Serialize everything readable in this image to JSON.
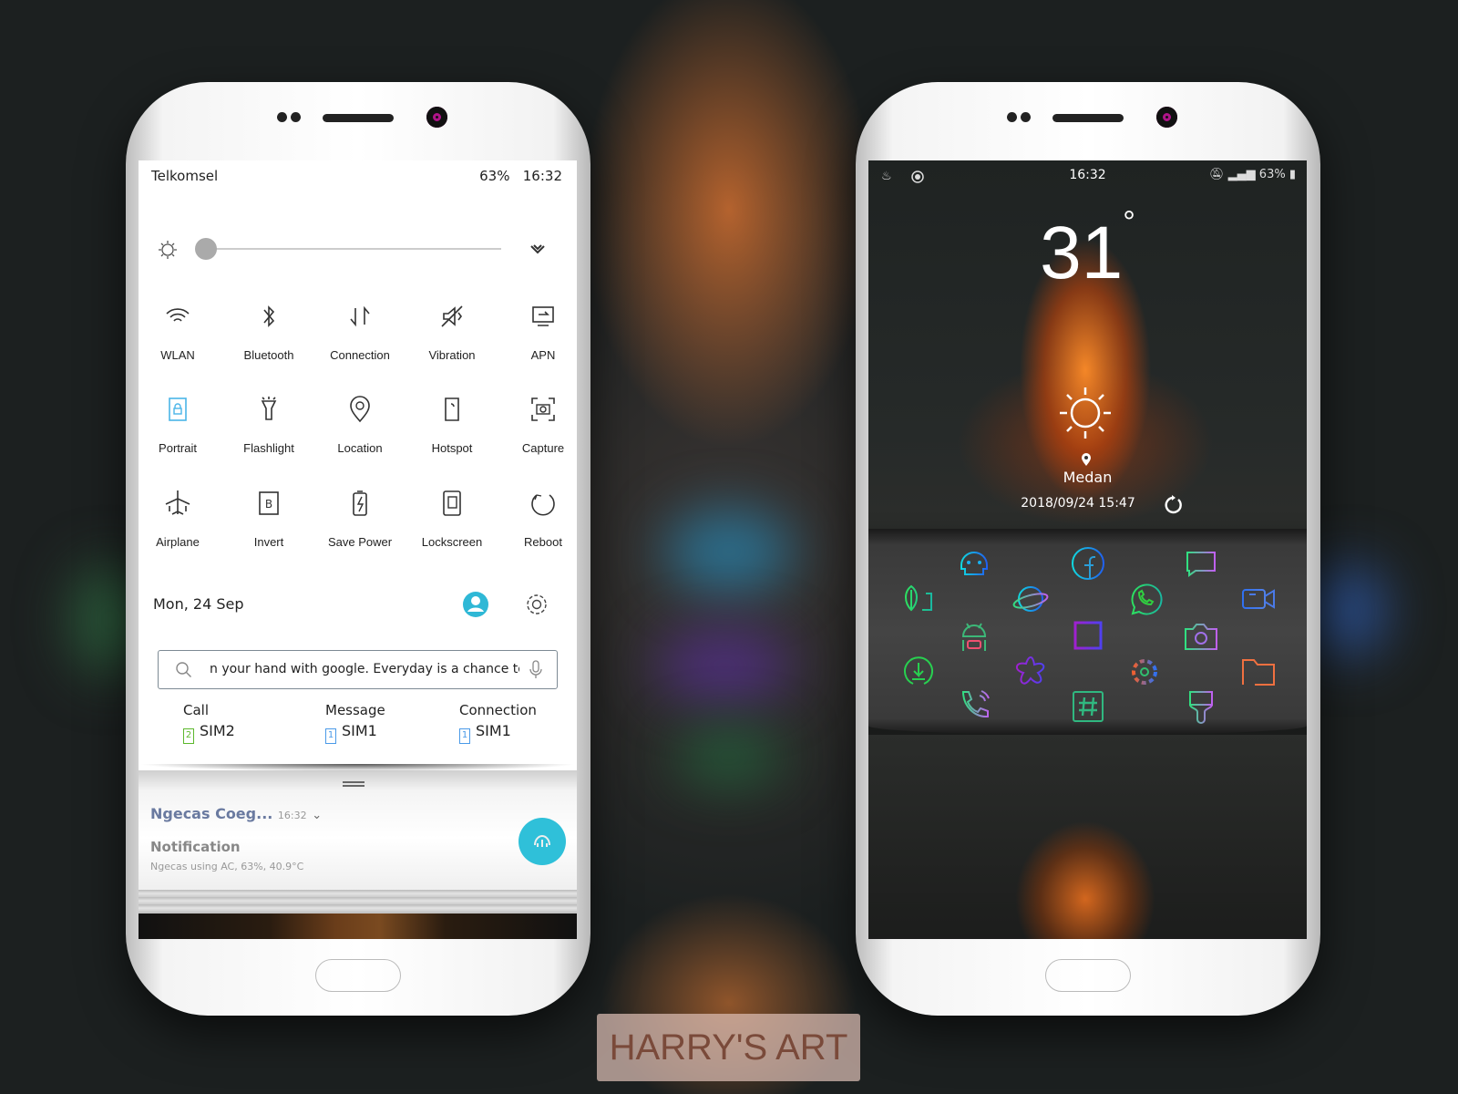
{
  "left_phone": {
    "status": {
      "carrier": "Telkomsel",
      "battery": "63%",
      "time": "16:32"
    },
    "brightness": {
      "level": 0.0
    },
    "quick_settings": [
      {
        "label": "WLAN",
        "icon": "wifi-icon",
        "active": false
      },
      {
        "label": "Bluetooth",
        "icon": "bluetooth-icon",
        "active": false
      },
      {
        "label": "Connection",
        "icon": "data-arrows-icon",
        "active": false
      },
      {
        "label": "Vibration",
        "icon": "mute-vibrate-icon",
        "active": false
      },
      {
        "label": "APN",
        "icon": "apn-icon",
        "active": false
      },
      {
        "label": "Portrait",
        "icon": "rotation-lock-icon",
        "active": true
      },
      {
        "label": "Flashlight",
        "icon": "flashlight-icon",
        "active": false
      },
      {
        "label": "Location",
        "icon": "location-icon",
        "active": false
      },
      {
        "label": "Hotspot",
        "icon": "hotspot-icon",
        "active": false
      },
      {
        "label": "Capture",
        "icon": "screenshot-icon",
        "active": false
      },
      {
        "label": "Airplane",
        "icon": "airplane-icon",
        "active": false
      },
      {
        "label": "Invert",
        "icon": "invert-icon",
        "active": false
      },
      {
        "label": "Save Power",
        "icon": "battery-saver-icon",
        "active": false
      },
      {
        "label": "Lockscreen",
        "icon": "lockscreen-icon",
        "active": false
      },
      {
        "label": "Reboot",
        "icon": "reboot-icon",
        "active": false
      }
    ],
    "date": "Mon, 24 Sep",
    "search": {
      "value": "n your hand with google. Everyday is a chance to"
    },
    "sim": [
      {
        "label": "Call",
        "sim": "SIM2",
        "num": "2",
        "color": "#5cb82c"
      },
      {
        "label": "Message",
        "sim": "SIM1",
        "num": "1",
        "color": "#4a9ae8"
      },
      {
        "label": "Connection",
        "sim": "SIM1",
        "num": "1",
        "color": "#4a9ae8"
      }
    ],
    "notification": {
      "app": "Ngecas Coeg...",
      "time": "16:32",
      "title": "Notification",
      "text": "Ngecas using AC, 63%, 40.9°C"
    },
    "accent": "#2fb8d6"
  },
  "right_phone": {
    "status": {
      "time": "16:32",
      "battery": "63%"
    },
    "weather": {
      "temp": "31",
      "degree": "°",
      "city": "Medan",
      "updated": "2018/09/24 15:47",
      "icon": "sun-icon"
    },
    "apps": [
      "leaf-app-icon",
      "skull-app-icon",
      "facebook-icon",
      "message-icon",
      "browser-planet-icon",
      "whatsapp-icon",
      "video-icon",
      "android-icon",
      "square-app-icon",
      "camera-icon",
      "download-icon",
      "flower-app-icon",
      "settings-icon",
      "folder-icon",
      "phone-icon",
      "hashtag-icon",
      "theme-brush-icon"
    ]
  },
  "watermark": "HARRY'S ART"
}
